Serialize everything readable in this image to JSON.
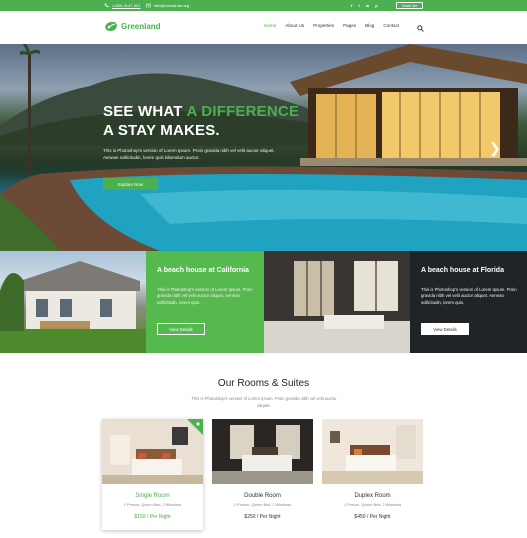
{
  "topbar": {
    "phone": "1-800-4147-321",
    "email": "info@domainde.org",
    "guide_label": "Guide Me",
    "socials": [
      {
        "icon": "facebook-icon",
        "glyph": "f"
      },
      {
        "icon": "twitter-icon",
        "glyph": "t"
      },
      {
        "icon": "linkedin-icon",
        "glyph": "in"
      },
      {
        "icon": "pinterest-icon",
        "glyph": "p"
      }
    ]
  },
  "brand": {
    "name": "Greenland",
    "color": "#4caf50"
  },
  "nav": {
    "items": [
      {
        "label": "Home",
        "active": true
      },
      {
        "label": "About Us",
        "active": false
      },
      {
        "label": "Properties",
        "active": false
      },
      {
        "label": "Pages",
        "active": false
      },
      {
        "label": "Blog",
        "active": false
      },
      {
        "label": "Contact",
        "active": false
      }
    ]
  },
  "hero": {
    "title_line1_part1": "SEE WHAT ",
    "title_line1_highlight": "A DIFFERENCE",
    "title_line2": "A STAY MAKES.",
    "text": "This is Photoshop's version of Lorem Ipsum. Proin gravida nibh vel velit auctor aliquet. Aenean sollicitudin, lorem quis bibendum auctor.",
    "button_label": "Explore Now",
    "arrow_glyph": "❯"
  },
  "features": [
    {
      "title": "A beach house at California",
      "text": "This is Photoshop's version of Lorem Ipsum. Proin gravida nibh vel velit auctor aliquet. Aenean sollicitudin, lorem quis.",
      "button_label": "View Details"
    },
    {
      "title": "A beach house at Florida",
      "text": "This is Photoshop's version of Lorem Ipsum. Proin gravida nibh vel velit auctor aliquet. Aenean sollicitudin, lorem quis.",
      "button_label": "View Details"
    }
  ],
  "rooms": {
    "heading": "Our Rooms & Suites",
    "subtitle": "This is Photoshop's version of Lorem Ipsum. Proin gravida nibh vel velit auctor aliquet.",
    "cards": [
      {
        "name": "Single Room",
        "meta": "1 Person, Queen Bed, 2 Windows",
        "price": "$150 / Per Night",
        "featured": true
      },
      {
        "name": "Double Room",
        "meta": "2 Person, Queen Bed, 2 Windows",
        "price": "$250 / Per Night",
        "featured": false
      },
      {
        "name": "Duplex Room",
        "meta": "1 Person, Queen Bed, 2 Windows",
        "price": "$450 / Per Night",
        "featured": false
      }
    ]
  }
}
